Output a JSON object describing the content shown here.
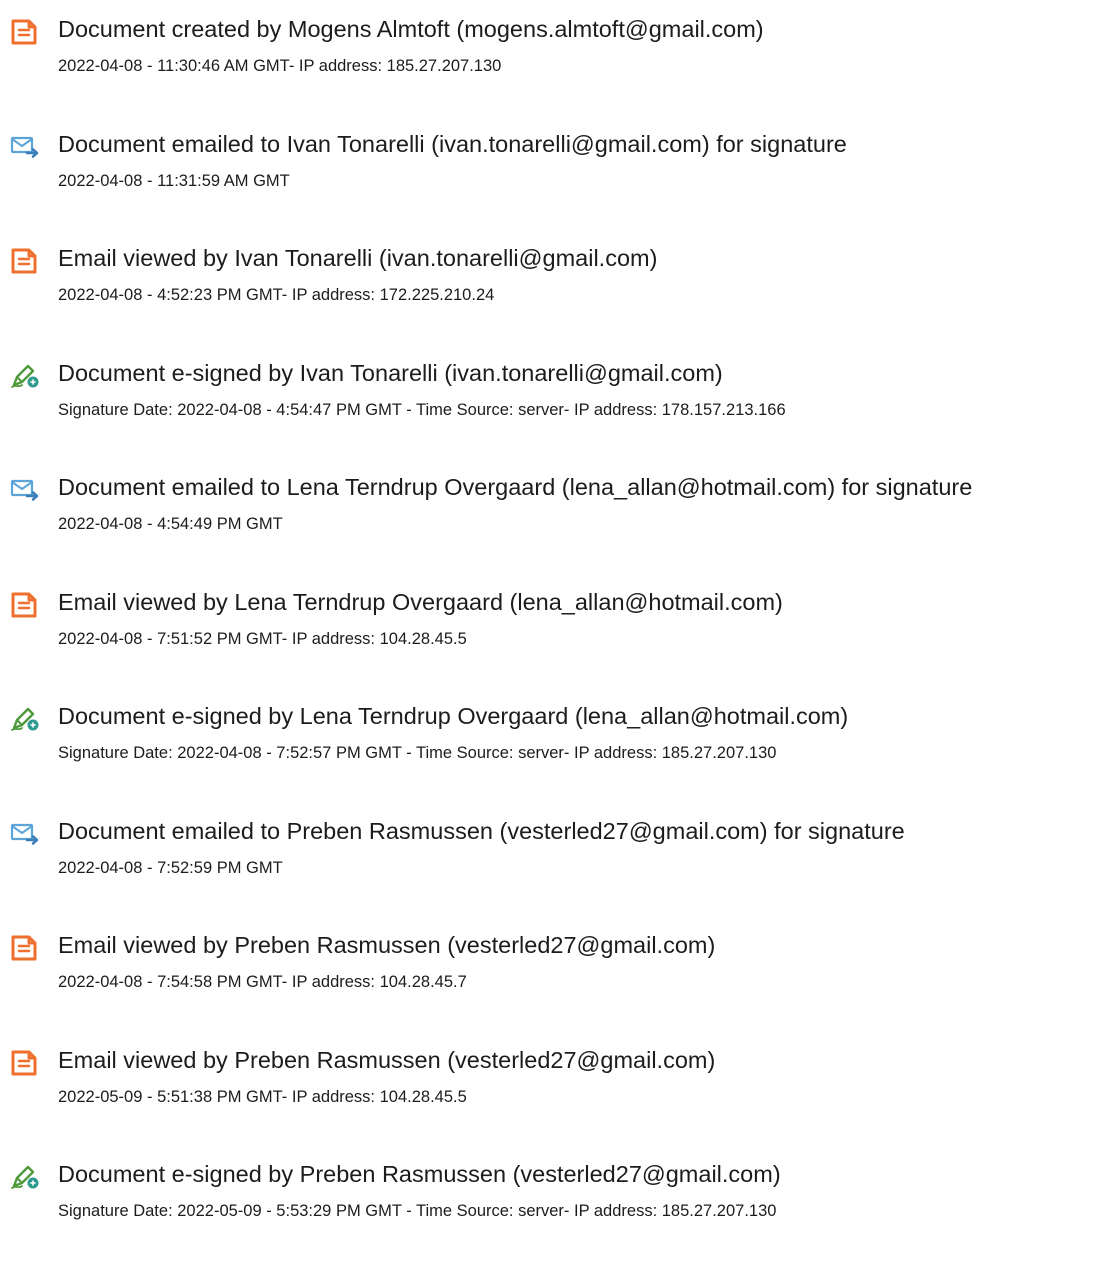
{
  "events": [
    {
      "icon": "document-created-icon",
      "title": "Document created by Mogens Almtoft (mogens.almtoft@gmail.com)",
      "detail": "2022-04-08 - 11:30:46 AM GMT- IP address: 185.27.207.130"
    },
    {
      "icon": "email-sent-icon",
      "title": "Document emailed to Ivan Tonarelli (ivan.tonarelli@gmail.com) for signature",
      "detail": "2022-04-08 - 11:31:59 AM GMT"
    },
    {
      "icon": "document-viewed-icon",
      "title": "Email viewed by Ivan Tonarelli (ivan.tonarelli@gmail.com)",
      "detail": "2022-04-08 - 4:52:23 PM GMT- IP address: 172.225.210.24"
    },
    {
      "icon": "esign-pen-icon",
      "title": "Document e-signed by Ivan Tonarelli (ivan.tonarelli@gmail.com)",
      "detail": "Signature Date: 2022-04-08 - 4:54:47 PM GMT - Time Source: server- IP address: 178.157.213.166"
    },
    {
      "icon": "email-sent-icon",
      "title": "Document emailed to Lena Terndrup Overgaard (lena_allan@hotmail.com) for signature",
      "detail": "2022-04-08 - 4:54:49 PM GMT"
    },
    {
      "icon": "document-viewed-icon",
      "title": "Email viewed by Lena Terndrup Overgaard (lena_allan@hotmail.com)",
      "detail": "2022-04-08 - 7:51:52 PM GMT- IP address: 104.28.45.5"
    },
    {
      "icon": "esign-pen-icon",
      "title": "Document e-signed by Lena Terndrup Overgaard (lena_allan@hotmail.com)",
      "detail": "Signature Date: 2022-04-08 - 7:52:57 PM GMT - Time Source: server- IP address: 185.27.207.130"
    },
    {
      "icon": "email-sent-icon",
      "title": "Document emailed to Preben Rasmussen (vesterled27@gmail.com) for signature",
      "detail": "2022-04-08 - 7:52:59 PM GMT"
    },
    {
      "icon": "document-viewed-icon",
      "title": "Email viewed by Preben Rasmussen (vesterled27@gmail.com)",
      "detail": "2022-04-08 - 7:54:58 PM GMT- IP address: 104.28.45.7"
    },
    {
      "icon": "document-viewed-icon",
      "title": "Email viewed by Preben Rasmussen (vesterled27@gmail.com)",
      "detail": "2022-05-09 - 5:51:38 PM GMT- IP address: 104.28.45.5"
    },
    {
      "icon": "esign-pen-icon",
      "title": "Document e-signed by Preben Rasmussen (vesterled27@gmail.com)",
      "detail": "Signature Date: 2022-05-09 - 5:53:29 PM GMT - Time Source: server- IP address: 185.27.207.130"
    }
  ],
  "colors": {
    "document_icon": "#ef6f2e",
    "email_icon": "#5aa4da",
    "pen_icon": "#4e9a3a",
    "text": "#1c1c1c"
  }
}
